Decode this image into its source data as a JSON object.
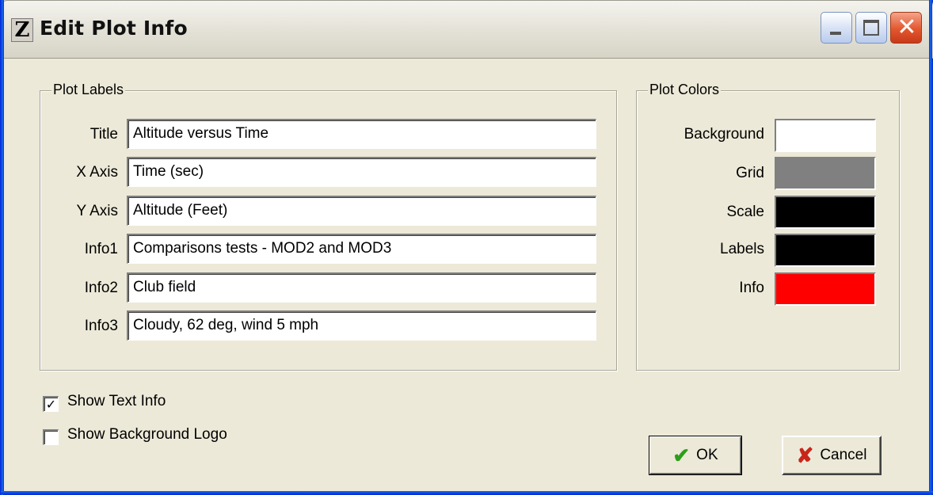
{
  "window": {
    "title": "Edit Plot Info",
    "app_icon_letter": "Z"
  },
  "plot_labels": {
    "group_title": "Plot Labels",
    "fields": [
      {
        "label": "Title",
        "value": "Altitude versus Time"
      },
      {
        "label": "X Axis",
        "value": "Time (sec)"
      },
      {
        "label": "Y Axis",
        "value": "Altitude (Feet)"
      },
      {
        "label": "Info1",
        "value": "Comparisons tests - MOD2 and MOD3"
      },
      {
        "label": "Info2",
        "value": "Club field"
      },
      {
        "label": "Info3",
        "value": "Cloudy, 62 deg, wind 5 mph"
      }
    ]
  },
  "plot_colors": {
    "group_title": "Plot Colors",
    "items": [
      {
        "label": "Background",
        "color": "#FFFFFF"
      },
      {
        "label": "Grid",
        "color": "#808080"
      },
      {
        "label": "Scale",
        "color": "#000000"
      },
      {
        "label": "Labels",
        "color": "#000000"
      },
      {
        "label": "Info",
        "color": "#FF0000"
      }
    ]
  },
  "options": {
    "show_text_info": {
      "label": "Show Text Info",
      "checked": true
    },
    "show_background_logo": {
      "label": "Show Background Logo",
      "checked": false
    }
  },
  "buttons": {
    "ok_label": "OK",
    "cancel_label": "Cancel"
  },
  "icons": {
    "app": "z-app-icon",
    "minimize": "minimize-icon",
    "maximize": "maximize-icon",
    "close": "close-icon",
    "ok": "checkmark-icon",
    "cancel": "x-mark-icon"
  }
}
